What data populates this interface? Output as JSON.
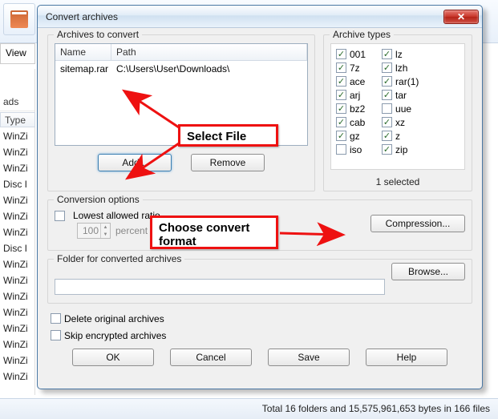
{
  "bg": {
    "view_tab": "View",
    "side_item": "ads",
    "type_header": "Type",
    "rows": [
      "WinZi",
      "WinZi",
      "WinZi",
      "Disc I",
      "WinZi",
      "WinZi",
      "WinZi",
      "Disc I",
      "WinZi",
      "WinZi",
      "WinZi",
      "WinZi",
      "WinZi",
      "WinZi",
      "WinZi",
      "WinZi"
    ],
    "status": "Total 16 folders and 15,575,961,653 bytes in 166 files"
  },
  "dialog": {
    "title": "Convert archives",
    "archives_group": "Archives to convert",
    "types_group": "Archive types",
    "cols": {
      "name": "Name",
      "path": "Path"
    },
    "row": {
      "name": "sitemap.rar",
      "path": "C:\\Users\\User\\Downloads\\"
    },
    "add": "Add...",
    "remove": "Remove",
    "types_col1": [
      {
        "label": "001",
        "checked": true
      },
      {
        "label": "7z",
        "checked": true
      },
      {
        "label": "ace",
        "checked": true
      },
      {
        "label": "arj",
        "checked": true
      },
      {
        "label": "bz2",
        "checked": true
      },
      {
        "label": "cab",
        "checked": true
      },
      {
        "label": "gz",
        "checked": true
      },
      {
        "label": "iso",
        "checked": false
      }
    ],
    "types_col2": [
      {
        "label": "lz",
        "checked": true
      },
      {
        "label": "lzh",
        "checked": true
      },
      {
        "label": "rar(1)",
        "checked": true
      },
      {
        "label": "tar",
        "checked": true
      },
      {
        "label": "uue",
        "checked": false
      },
      {
        "label": "xz",
        "checked": true
      },
      {
        "label": "z",
        "checked": true
      },
      {
        "label": "zip",
        "checked": true
      }
    ],
    "selected_text": "1 selected",
    "conv_group": "Conversion options",
    "lowest": "Lowest allowed ratio",
    "ratio": "100",
    "percent": "percent",
    "compression": "Compression...",
    "folder_group": "Folder for converted archives",
    "browse": "Browse...",
    "delete_orig": "Delete original archives",
    "skip_enc": "Skip encrypted archives",
    "ok": "OK",
    "cancel": "Cancel",
    "save": "Save",
    "help": "Help"
  },
  "ann": {
    "selectfile": "Select File",
    "choose": "Choose convert\nformat"
  }
}
